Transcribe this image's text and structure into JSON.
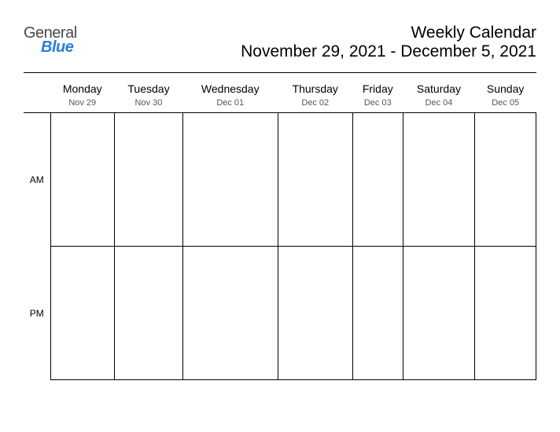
{
  "logo": {
    "line1": "General",
    "line2": "Blue"
  },
  "header": {
    "title": "Weekly Calendar",
    "date_range": "November 29, 2021 - December 5, 2021"
  },
  "days": [
    {
      "name": "Monday",
      "date": "Nov 29"
    },
    {
      "name": "Tuesday",
      "date": "Nov 30"
    },
    {
      "name": "Wednesday",
      "date": "Dec 01"
    },
    {
      "name": "Thursday",
      "date": "Dec 02"
    },
    {
      "name": "Friday",
      "date": "Dec 03"
    },
    {
      "name": "Saturday",
      "date": "Dec 04"
    },
    {
      "name": "Sunday",
      "date": "Dec 05"
    }
  ],
  "periods": {
    "am": "AM",
    "pm": "PM"
  }
}
